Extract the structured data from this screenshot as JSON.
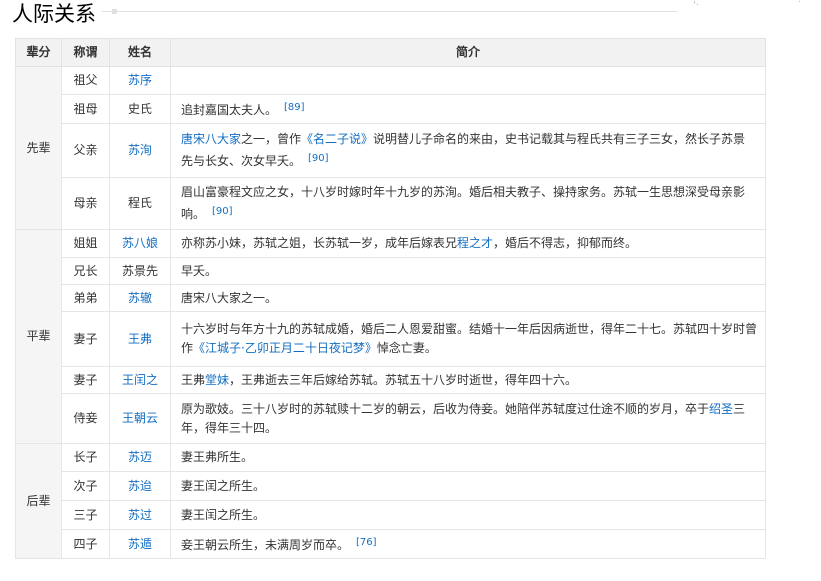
{
  "section_title": "人际关系",
  "headers": {
    "gen": "辈分",
    "rel": "称谓",
    "name": "姓名",
    "desc": "简介"
  },
  "groups": [
    {
      "label": "先辈",
      "rows": [
        {
          "rel": "祖父",
          "name": "苏序",
          "name_link": true,
          "desc": []
        },
        {
          "rel": "祖母",
          "name": "史氏",
          "name_link": false,
          "desc": [
            {
              "t": "追封嘉国太夫人。"
            },
            {
              "ref": "[89]"
            }
          ]
        },
        {
          "rel": "父亲",
          "name": "苏洵",
          "name_link": true,
          "desc": [
            {
              "t": "唐宋八大家",
              "link": true
            },
            {
              "t": "之一，曾作"
            },
            {
              "t": "《名二子说》",
              "link": true
            },
            {
              "t": "说明替儿子命名的来由，史书记载其与程氏共有三子三女，然长子苏景先与长女、次女早夭。"
            },
            {
              "ref": "[90]"
            }
          ]
        },
        {
          "rel": "母亲",
          "name": "程氏",
          "name_link": false,
          "desc": [
            {
              "t": "眉山富豪程文应之女，十八岁时嫁时年十九岁的苏洵。婚后相夫教子、操持家务。苏轼一生思想深受母亲影响。"
            },
            {
              "ref": "[90]"
            }
          ]
        }
      ]
    },
    {
      "label": "平辈",
      "rows": [
        {
          "rel": "姐姐",
          "name": "苏八娘",
          "name_link": true,
          "desc": [
            {
              "t": "亦称苏小妹，苏轼之姐，长苏轼一岁，成年后嫁表兄"
            },
            {
              "t": "程之才",
              "link": true
            },
            {
              "t": "，婚后不得志，抑郁而终。"
            }
          ]
        },
        {
          "rel": "兄长",
          "name": "苏景先",
          "name_link": false,
          "desc": [
            {
              "t": "早夭。"
            }
          ]
        },
        {
          "rel": "弟弟",
          "name": "苏辙",
          "name_link": true,
          "desc": [
            {
              "t": "唐宋八大家之一。"
            }
          ]
        },
        {
          "rel": "妻子",
          "name": "王弗",
          "name_link": true,
          "desc": [
            {
              "t": "十六岁时与年方十九的苏轼成婚，婚后二人恩爱甜蜜。结婚十一年后因病逝世，得年二十七。苏轼四十岁时曾作"
            },
            {
              "t": "《江城子·乙卯正月二十日夜记梦》",
              "link": true
            },
            {
              "t": "悼念亡妻。"
            }
          ]
        },
        {
          "rel": "妻子",
          "name": "王闰之",
          "name_link": true,
          "desc": [
            {
              "t": "王弗"
            },
            {
              "t": "堂妹",
              "link": true
            },
            {
              "t": "，王弗逝去三年后嫁给苏轼。苏轼五十八岁时逝世，得年四十六。"
            }
          ]
        },
        {
          "rel": "侍妾",
          "name": "王朝云",
          "name_link": true,
          "desc": [
            {
              "t": "原为歌妓。三十八岁时的苏轼赎十二岁的朝云，后收为侍妾。她陪伴苏轼度过仕途不顺的岁月，卒于"
            },
            {
              "t": "绍圣",
              "link": true
            },
            {
              "t": "三年，得年三十四。"
            }
          ]
        }
      ]
    },
    {
      "label": "后辈",
      "rows": [
        {
          "rel": "长子",
          "name": "苏迈",
          "name_link": true,
          "desc": [
            {
              "t": "妻王弗所生。"
            }
          ]
        },
        {
          "rel": "次子",
          "name": "苏迨",
          "name_link": true,
          "desc": [
            {
              "t": "妻王闰之所生。"
            }
          ]
        },
        {
          "rel": "三子",
          "name": "苏过",
          "name_link": true,
          "desc": [
            {
              "t": "妻王闰之所生。"
            }
          ]
        },
        {
          "rel": "四子",
          "name": "苏遁",
          "name_link": true,
          "desc": [
            {
              "t": "妾王朝云所生，未满周岁而卒。"
            },
            {
              "ref": "[76]"
            }
          ]
        }
      ]
    }
  ]
}
